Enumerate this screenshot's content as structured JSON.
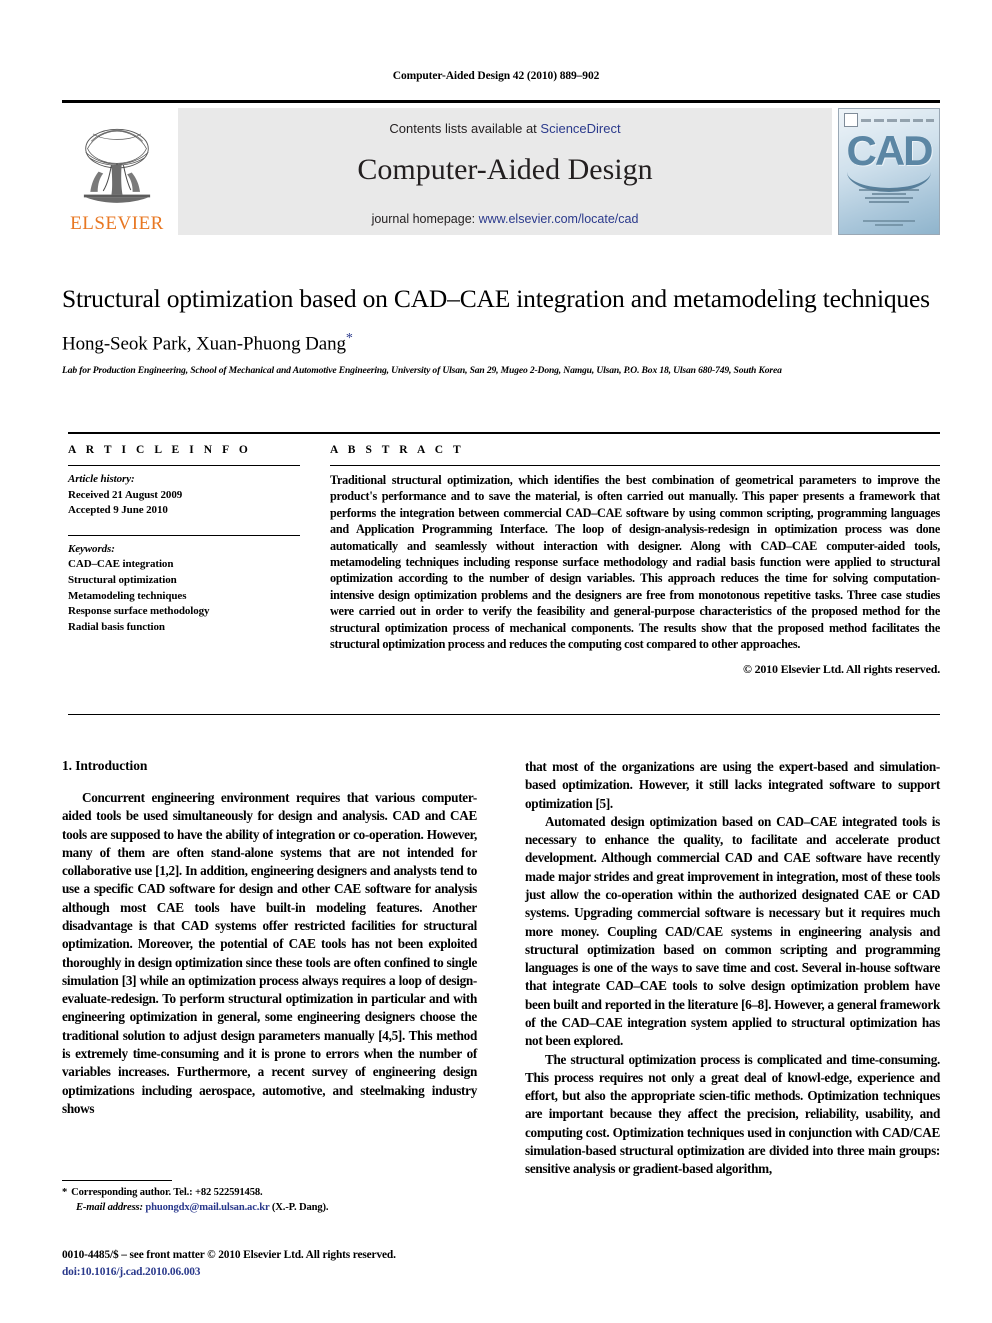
{
  "running_head": "Computer-Aided Design 42 (2010) 889–902",
  "masthead": {
    "publisher_logo_label": "ELSEVIER",
    "contents_prefix": "Contents lists available at ",
    "contents_link": "ScienceDirect",
    "journal_title": "Computer-Aided Design",
    "homepage_prefix": "journal homepage: ",
    "homepage_url": "www.elsevier.com/locate/cad",
    "cover_title": "CAD"
  },
  "title_block": {
    "title": "Structural optimization based on CAD–CAE integration and metamodeling techniques",
    "authors": "Hong-Seok Park, Xuan-Phuong Dang",
    "corresponding_marker": "*",
    "affiliation": "Lab for Production Engineering, School of Mechanical and Automotive Engineering, University of Ulsan, San 29, Mugeo 2-Dong, Namgu, Ulsan, P.O. Box 18, Ulsan 680-749, South Korea"
  },
  "article_info": {
    "label": "A R T I C L E    I N F O",
    "history_label": "Article history:",
    "history": [
      "Received 21 August 2009",
      "Accepted 9 June 2010"
    ],
    "keywords_label": "Keywords:",
    "keywords": [
      "CAD–CAE integration",
      "Structural optimization",
      "Metamodeling techniques",
      "Response surface methodology",
      "Radial basis function"
    ]
  },
  "abstract": {
    "label": "A B S T R A C T",
    "text": "Traditional structural optimization, which identifies the best combination of geometrical parameters to improve the product's performance and to save the material, is often carried out manually. This paper presents a framework that performs the integration between commercial CAD–CAE software by using common scripting, programming languages and Application Programming Interface. The loop of design-analysis-redesign in optimization process was done automatically and seamlessly without interaction with designer. Along with CAD–CAE computer-aided tools, metamodeling techniques including response surface methodology and radial basis function were applied to structural optimization according to the number of design variables. This approach reduces the time for solving computation-intensive design optimization problems and the designers are free from monotonous repetitive tasks. Three case studies were carried out in order to verify the feasibility and general-purpose characteristics of the proposed method for the structural optimization process of mechanical components. The results show that the proposed method facilitates the structural optimization process and reduces the computing cost compared to other approaches.",
    "copyright": "© 2010 Elsevier Ltd. All rights reserved."
  },
  "body": {
    "section_heading": "1. Introduction",
    "left_paragraphs": [
      "Concurrent engineering environment requires that various computer-aided tools be used simultaneously for design and analysis. CAD and CAE tools are supposed to have the ability of integration or co-operation. However, many of them are often stand-alone systems that are not intended for collaborative use [1,2]. In addition, engineering designers and analysts tend to use a specific CAD software for design and other CAE software for analysis although most CAE tools have built-in modeling features. Another disadvantage is that CAD systems offer restricted facilities for structural optimization. Moreover, the potential of CAE tools has not been exploited thoroughly in design optimization since these tools are often confined to single simulation [3] while an optimization process always requires a loop of design-evaluate-redesign. To perform structural optimization in particular and with engineering optimization in general, some engineering designers choose the traditional solution to adjust design parameters manually [4,5]. This method is extremely time-consuming and it is prone to errors when the number of variables increases. Furthermore, a recent survey of engineering design optimizations including aerospace, automotive, and steelmaking industry shows"
    ],
    "right_paragraphs": [
      "that most of the organizations are using the expert-based and simulation-based optimization. However, it still lacks integrated software to support optimization [5].",
      "Automated design optimization based on CAD–CAE integrated tools is necessary to enhance the quality, to facilitate and accelerate product development. Although commercial CAD and CAE software have recently made major strides and great improvement in integration, most of these tools just allow the co-operation within the authorized designated CAE or CAD systems. Upgrading commercial software is necessary but it requires much more money. Coupling CAD/CAE systems in engineering analysis and structural optimization based on common scripting and programming languages is one of the ways to save time and cost. Several in-house software that integrate CAD–CAE tools to solve design optimization problem have been built and reported in the literature [6–8]. However, a general framework of the CAD–CAE integration system applied to structural optimization has not been explored.",
      "The structural optimization process is complicated and time-consuming. This process requires not only a great deal of knowl-edge, experience and effort, but also the appropriate scien-tific methods. Optimization techniques are important because they affect the precision, reliability, usability, and computing cost. Optimization techniques used in conjunction with CAD/CAE simulation-based structural optimization are divided into three main groups: sensitive analysis or gradient-based algorithm,"
    ]
  },
  "footnote": {
    "marker": "*",
    "corresponding": "Corresponding author. Tel.: +82 522591458.",
    "email_label": "E-mail address:",
    "email": "phuongdx@mail.ulsan.ac.kr",
    "email_suffix": "(X.-P. Dang)."
  },
  "imprint": {
    "issn_line": "0010-4485/$ – see front matter © 2010 Elsevier Ltd. All rights reserved.",
    "doi": "doi:10.1016/j.cad.2010.06.003"
  },
  "colors": {
    "link_blue": "#2b3a8c",
    "elsevier_orange": "#E87722",
    "banner_gray": "#e9e9e9"
  }
}
